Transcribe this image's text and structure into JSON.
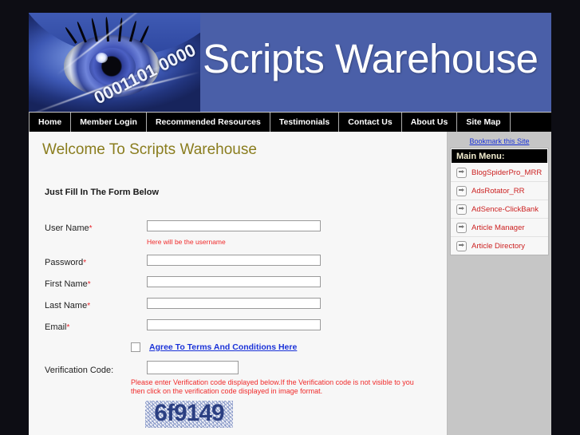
{
  "banner": {
    "title": "Scripts Warehouse",
    "binary_overlay": "0001101 0000"
  },
  "nav": {
    "items": [
      {
        "label": "Home"
      },
      {
        "label": "Member Login"
      },
      {
        "label": "Recommended Resources"
      },
      {
        "label": "Testimonials"
      },
      {
        "label": "Contact Us"
      },
      {
        "label": "About Us"
      },
      {
        "label": "Site Map"
      }
    ]
  },
  "main": {
    "page_title": "Welcome To Scripts Warehouse",
    "form_heading": "Just Fill In The Form Below",
    "fields": [
      {
        "label": "User Name",
        "required_mark": "*",
        "value": "",
        "hint": "Here will be the username"
      },
      {
        "label": "Password",
        "required_mark": "*",
        "value": "",
        "hint": ""
      },
      {
        "label": "First Name",
        "required_mark": "*",
        "value": "",
        "hint": ""
      },
      {
        "label": "Last Name",
        "required_mark": "*",
        "value": "",
        "hint": ""
      },
      {
        "label": "Email",
        "required_mark": "*",
        "value": "",
        "hint": ""
      }
    ],
    "terms": {
      "checked": false,
      "link_label": "Agree To Terms And Conditions Here"
    },
    "verification": {
      "label": "Verification Code:",
      "value": "",
      "message": "Please enter Verification code displayed below.If the Verification code is not visible to you then click on the verification code displayed in image format.",
      "captcha_text": "6f9149"
    }
  },
  "sidebar": {
    "bookmark_label": "Bookmark this Site",
    "menu_header": "Main Menu:",
    "menu_items": [
      {
        "label": "BlogSpiderPro_MRR"
      },
      {
        "label": "AdsRotator_RR"
      },
      {
        "label": "AdSence-ClickBank"
      },
      {
        "label": "Article Manager"
      },
      {
        "label": "Article Directory"
      }
    ]
  },
  "colors": {
    "banner_bg": "#4a5fa8",
    "nav_bg": "#000000",
    "title_olive": "#8a7d1e",
    "link_blue": "#1a32d8",
    "alert_red": "#f02b2b",
    "menu_red": "#cc2121",
    "captcha_blue": "#2b3f82"
  }
}
